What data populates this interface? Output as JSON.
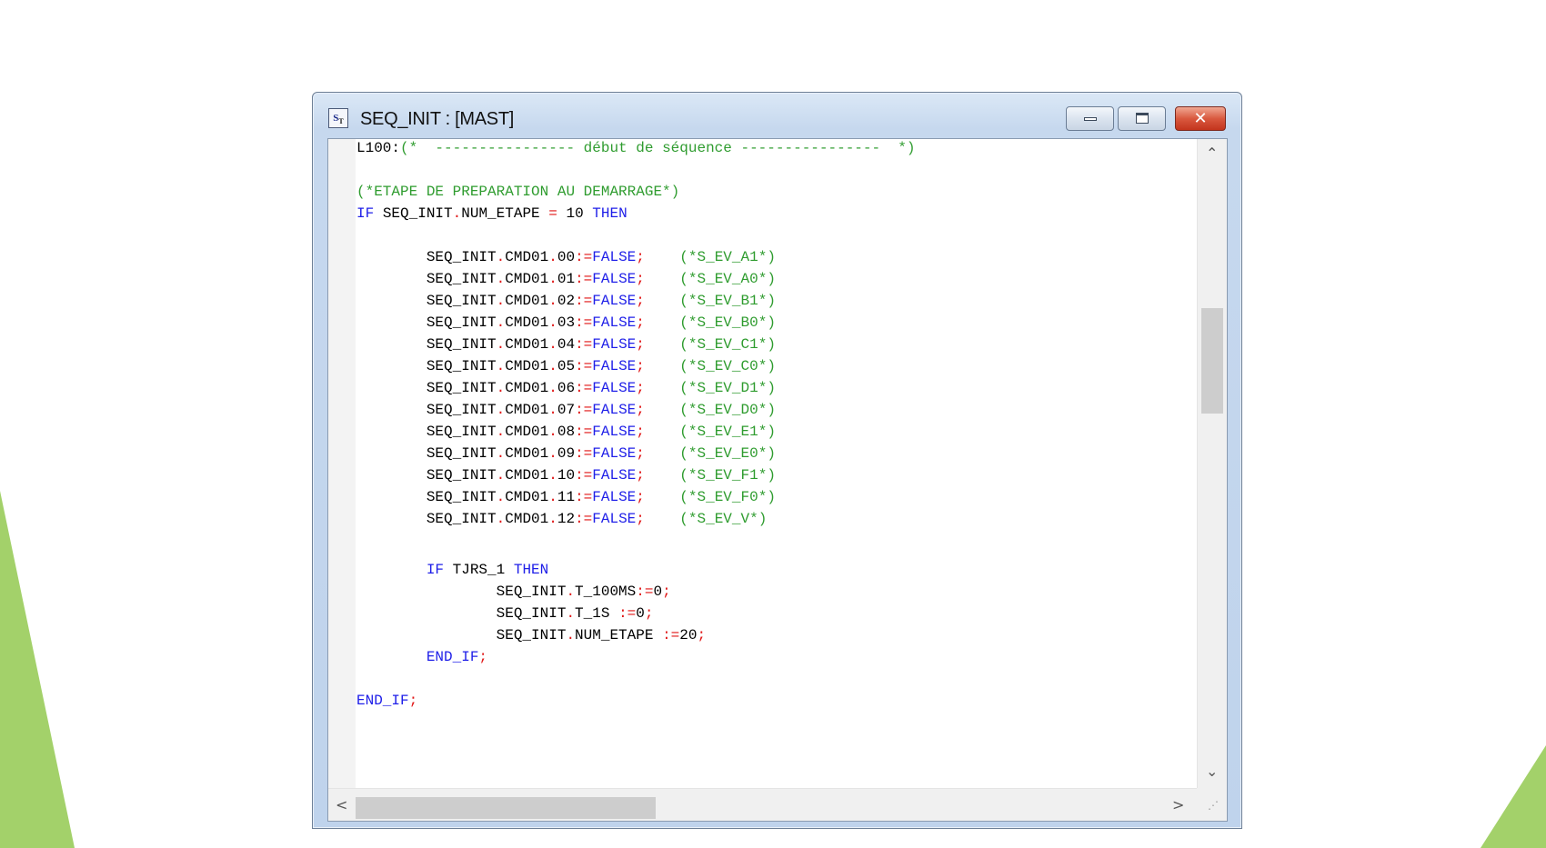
{
  "window": {
    "title": "SEQ_INIT : [MAST]",
    "icon": "structured-text-icon",
    "controls": {
      "minimize": "minimize-icon",
      "maximize": "maximize-icon",
      "close": "close-icon",
      "close_glyph": "✕"
    }
  },
  "editor": {
    "lines": [
      [
        {
          "t": "L100:",
          "c": "tx"
        },
        {
          "t": "(*  ---------------- début de séquence ----------------  *)",
          "c": "cm"
        }
      ],
      [],
      [
        {
          "t": "(*ETAPE DE PREPARATION AU DEMARRAGE*)",
          "c": "cm"
        }
      ],
      [
        {
          "t": "IF ",
          "c": "kw"
        },
        {
          "t": "SEQ_INIT",
          "c": "tx"
        },
        {
          "t": ".",
          "c": "op"
        },
        {
          "t": "NUM_ETAPE ",
          "c": "tx"
        },
        {
          "t": "=",
          "c": "op"
        },
        {
          "t": " 10 ",
          "c": "tx"
        },
        {
          "t": "THEN",
          "c": "kw"
        }
      ],
      [],
      [
        {
          "t": "        SEQ_INIT",
          "c": "tx"
        },
        {
          "t": ".",
          "c": "op"
        },
        {
          "t": "CMD01",
          "c": "tx"
        },
        {
          "t": ".",
          "c": "op"
        },
        {
          "t": "00",
          "c": "tx"
        },
        {
          "t": ":=",
          "c": "op"
        },
        {
          "t": "FALSE",
          "c": "kw"
        },
        {
          "t": ";",
          "c": "op"
        },
        {
          "t": "    (*S_EV_A1*)",
          "c": "cm"
        }
      ],
      [
        {
          "t": "        SEQ_INIT",
          "c": "tx"
        },
        {
          "t": ".",
          "c": "op"
        },
        {
          "t": "CMD01",
          "c": "tx"
        },
        {
          "t": ".",
          "c": "op"
        },
        {
          "t": "01",
          "c": "tx"
        },
        {
          "t": ":=",
          "c": "op"
        },
        {
          "t": "FALSE",
          "c": "kw"
        },
        {
          "t": ";",
          "c": "op"
        },
        {
          "t": "    (*S_EV_A0*)",
          "c": "cm"
        }
      ],
      [
        {
          "t": "        SEQ_INIT",
          "c": "tx"
        },
        {
          "t": ".",
          "c": "op"
        },
        {
          "t": "CMD01",
          "c": "tx"
        },
        {
          "t": ".",
          "c": "op"
        },
        {
          "t": "02",
          "c": "tx"
        },
        {
          "t": ":=",
          "c": "op"
        },
        {
          "t": "FALSE",
          "c": "kw"
        },
        {
          "t": ";",
          "c": "op"
        },
        {
          "t": "    (*S_EV_B1*)",
          "c": "cm"
        }
      ],
      [
        {
          "t": "        SEQ_INIT",
          "c": "tx"
        },
        {
          "t": ".",
          "c": "op"
        },
        {
          "t": "CMD01",
          "c": "tx"
        },
        {
          "t": ".",
          "c": "op"
        },
        {
          "t": "03",
          "c": "tx"
        },
        {
          "t": ":=",
          "c": "op"
        },
        {
          "t": "FALSE",
          "c": "kw"
        },
        {
          "t": ";",
          "c": "op"
        },
        {
          "t": "    (*S_EV_B0*)",
          "c": "cm"
        }
      ],
      [
        {
          "t": "        SEQ_INIT",
          "c": "tx"
        },
        {
          "t": ".",
          "c": "op"
        },
        {
          "t": "CMD01",
          "c": "tx"
        },
        {
          "t": ".",
          "c": "op"
        },
        {
          "t": "04",
          "c": "tx"
        },
        {
          "t": ":=",
          "c": "op"
        },
        {
          "t": "FALSE",
          "c": "kw"
        },
        {
          "t": ";",
          "c": "op"
        },
        {
          "t": "    (*S_EV_C1*)",
          "c": "cm"
        }
      ],
      [
        {
          "t": "        SEQ_INIT",
          "c": "tx"
        },
        {
          "t": ".",
          "c": "op"
        },
        {
          "t": "CMD01",
          "c": "tx"
        },
        {
          "t": ".",
          "c": "op"
        },
        {
          "t": "05",
          "c": "tx"
        },
        {
          "t": ":=",
          "c": "op"
        },
        {
          "t": "FALSE",
          "c": "kw"
        },
        {
          "t": ";",
          "c": "op"
        },
        {
          "t": "    (*S_EV_C0*)",
          "c": "cm"
        }
      ],
      [
        {
          "t": "        SEQ_INIT",
          "c": "tx"
        },
        {
          "t": ".",
          "c": "op"
        },
        {
          "t": "CMD01",
          "c": "tx"
        },
        {
          "t": ".",
          "c": "op"
        },
        {
          "t": "06",
          "c": "tx"
        },
        {
          "t": ":=",
          "c": "op"
        },
        {
          "t": "FALSE",
          "c": "kw"
        },
        {
          "t": ";",
          "c": "op"
        },
        {
          "t": "    (*S_EV_D1*)",
          "c": "cm"
        }
      ],
      [
        {
          "t": "        SEQ_INIT",
          "c": "tx"
        },
        {
          "t": ".",
          "c": "op"
        },
        {
          "t": "CMD01",
          "c": "tx"
        },
        {
          "t": ".",
          "c": "op"
        },
        {
          "t": "07",
          "c": "tx"
        },
        {
          "t": ":=",
          "c": "op"
        },
        {
          "t": "FALSE",
          "c": "kw"
        },
        {
          "t": ";",
          "c": "op"
        },
        {
          "t": "    (*S_EV_D0*)",
          "c": "cm"
        }
      ],
      [
        {
          "t": "        SEQ_INIT",
          "c": "tx"
        },
        {
          "t": ".",
          "c": "op"
        },
        {
          "t": "CMD01",
          "c": "tx"
        },
        {
          "t": ".",
          "c": "op"
        },
        {
          "t": "08",
          "c": "tx"
        },
        {
          "t": ":=",
          "c": "op"
        },
        {
          "t": "FALSE",
          "c": "kw"
        },
        {
          "t": ";",
          "c": "op"
        },
        {
          "t": "    (*S_EV_E1*)",
          "c": "cm"
        }
      ],
      [
        {
          "t": "        SEQ_INIT",
          "c": "tx"
        },
        {
          "t": ".",
          "c": "op"
        },
        {
          "t": "CMD01",
          "c": "tx"
        },
        {
          "t": ".",
          "c": "op"
        },
        {
          "t": "09",
          "c": "tx"
        },
        {
          "t": ":=",
          "c": "op"
        },
        {
          "t": "FALSE",
          "c": "kw"
        },
        {
          "t": ";",
          "c": "op"
        },
        {
          "t": "    (*S_EV_E0*)",
          "c": "cm"
        }
      ],
      [
        {
          "t": "        SEQ_INIT",
          "c": "tx"
        },
        {
          "t": ".",
          "c": "op"
        },
        {
          "t": "CMD01",
          "c": "tx"
        },
        {
          "t": ".",
          "c": "op"
        },
        {
          "t": "10",
          "c": "tx"
        },
        {
          "t": ":=",
          "c": "op"
        },
        {
          "t": "FALSE",
          "c": "kw"
        },
        {
          "t": ";",
          "c": "op"
        },
        {
          "t": "    (*S_EV_F1*)",
          "c": "cm"
        }
      ],
      [
        {
          "t": "        SEQ_INIT",
          "c": "tx"
        },
        {
          "t": ".",
          "c": "op"
        },
        {
          "t": "CMD01",
          "c": "tx"
        },
        {
          "t": ".",
          "c": "op"
        },
        {
          "t": "11",
          "c": "tx"
        },
        {
          "t": ":=",
          "c": "op"
        },
        {
          "t": "FALSE",
          "c": "kw"
        },
        {
          "t": ";",
          "c": "op"
        },
        {
          "t": "    (*S_EV_F0*)",
          "c": "cm"
        }
      ],
      [
        {
          "t": "        SEQ_INIT",
          "c": "tx"
        },
        {
          "t": ".",
          "c": "op"
        },
        {
          "t": "CMD01",
          "c": "tx"
        },
        {
          "t": ".",
          "c": "op"
        },
        {
          "t": "12",
          "c": "tx"
        },
        {
          "t": ":=",
          "c": "op"
        },
        {
          "t": "FALSE",
          "c": "kw"
        },
        {
          "t": ";",
          "c": "op"
        },
        {
          "t": "    (*S_EV_V*)",
          "c": "cm"
        }
      ],
      [],
      [
        {
          "t": "        IF ",
          "c": "kw"
        },
        {
          "t": "TJRS_1 ",
          "c": "tx"
        },
        {
          "t": "THEN",
          "c": "kw"
        }
      ],
      [
        {
          "t": "                SEQ_INIT",
          "c": "tx"
        },
        {
          "t": ".",
          "c": "op"
        },
        {
          "t": "T_100MS",
          "c": "tx"
        },
        {
          "t": ":=",
          "c": "op"
        },
        {
          "t": "0",
          "c": "tx"
        },
        {
          "t": ";",
          "c": "op"
        }
      ],
      [
        {
          "t": "                SEQ_INIT",
          "c": "tx"
        },
        {
          "t": ".",
          "c": "op"
        },
        {
          "t": "T_1S ",
          "c": "tx"
        },
        {
          "t": ":=",
          "c": "op"
        },
        {
          "t": "0",
          "c": "tx"
        },
        {
          "t": ";",
          "c": "op"
        }
      ],
      [
        {
          "t": "                SEQ_INIT",
          "c": "tx"
        },
        {
          "t": ".",
          "c": "op"
        },
        {
          "t": "NUM_ETAPE ",
          "c": "tx"
        },
        {
          "t": ":=",
          "c": "op"
        },
        {
          "t": "20",
          "c": "tx"
        },
        {
          "t": ";",
          "c": "op"
        }
      ],
      [
        {
          "t": "        END_IF",
          "c": "kw"
        },
        {
          "t": ";",
          "c": "op"
        }
      ],
      [],
      [
        {
          "t": "END_IF",
          "c": "kw"
        },
        {
          "t": ";",
          "c": "op"
        }
      ]
    ]
  },
  "scrollbars": {
    "up": "▲",
    "down": "▼",
    "left": "◀",
    "right": "▶",
    "up_icon": "chevron-up-icon",
    "down_icon": "chevron-down-icon",
    "left_icon": "chevron-left-icon",
    "right_icon": "chevron-right-icon",
    "resize_grip": "⋰"
  },
  "colors": {
    "keyword": "#1f1fe8",
    "operator": "#e01616",
    "comment": "#2f9c2f",
    "text": "#000000",
    "slide_accent": "#a3d16a"
  }
}
